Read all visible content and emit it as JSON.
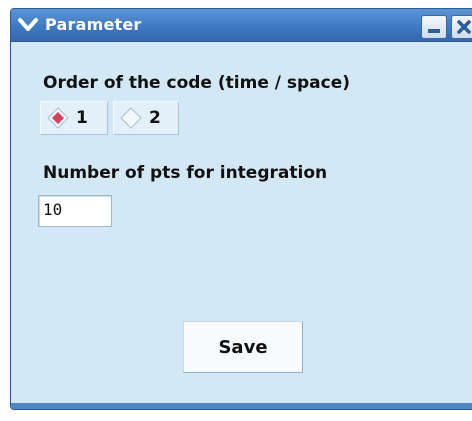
{
  "window": {
    "title": "Parameter",
    "menu_icon": "chevron-down-icon",
    "minimize_icon": "minimize-icon",
    "close_icon": "close-icon"
  },
  "order": {
    "label": "Order of the code (time / space)",
    "options": [
      {
        "label": "1",
        "selected": true
      },
      {
        "label": "2",
        "selected": false
      }
    ]
  },
  "points": {
    "label": "Number of pts for integration",
    "value": "10"
  },
  "save_button": {
    "label": "Save"
  },
  "colors": {
    "titlebar": "#3f79c2",
    "background": "#d3e8f5",
    "radio_selected": "#d9415a"
  }
}
